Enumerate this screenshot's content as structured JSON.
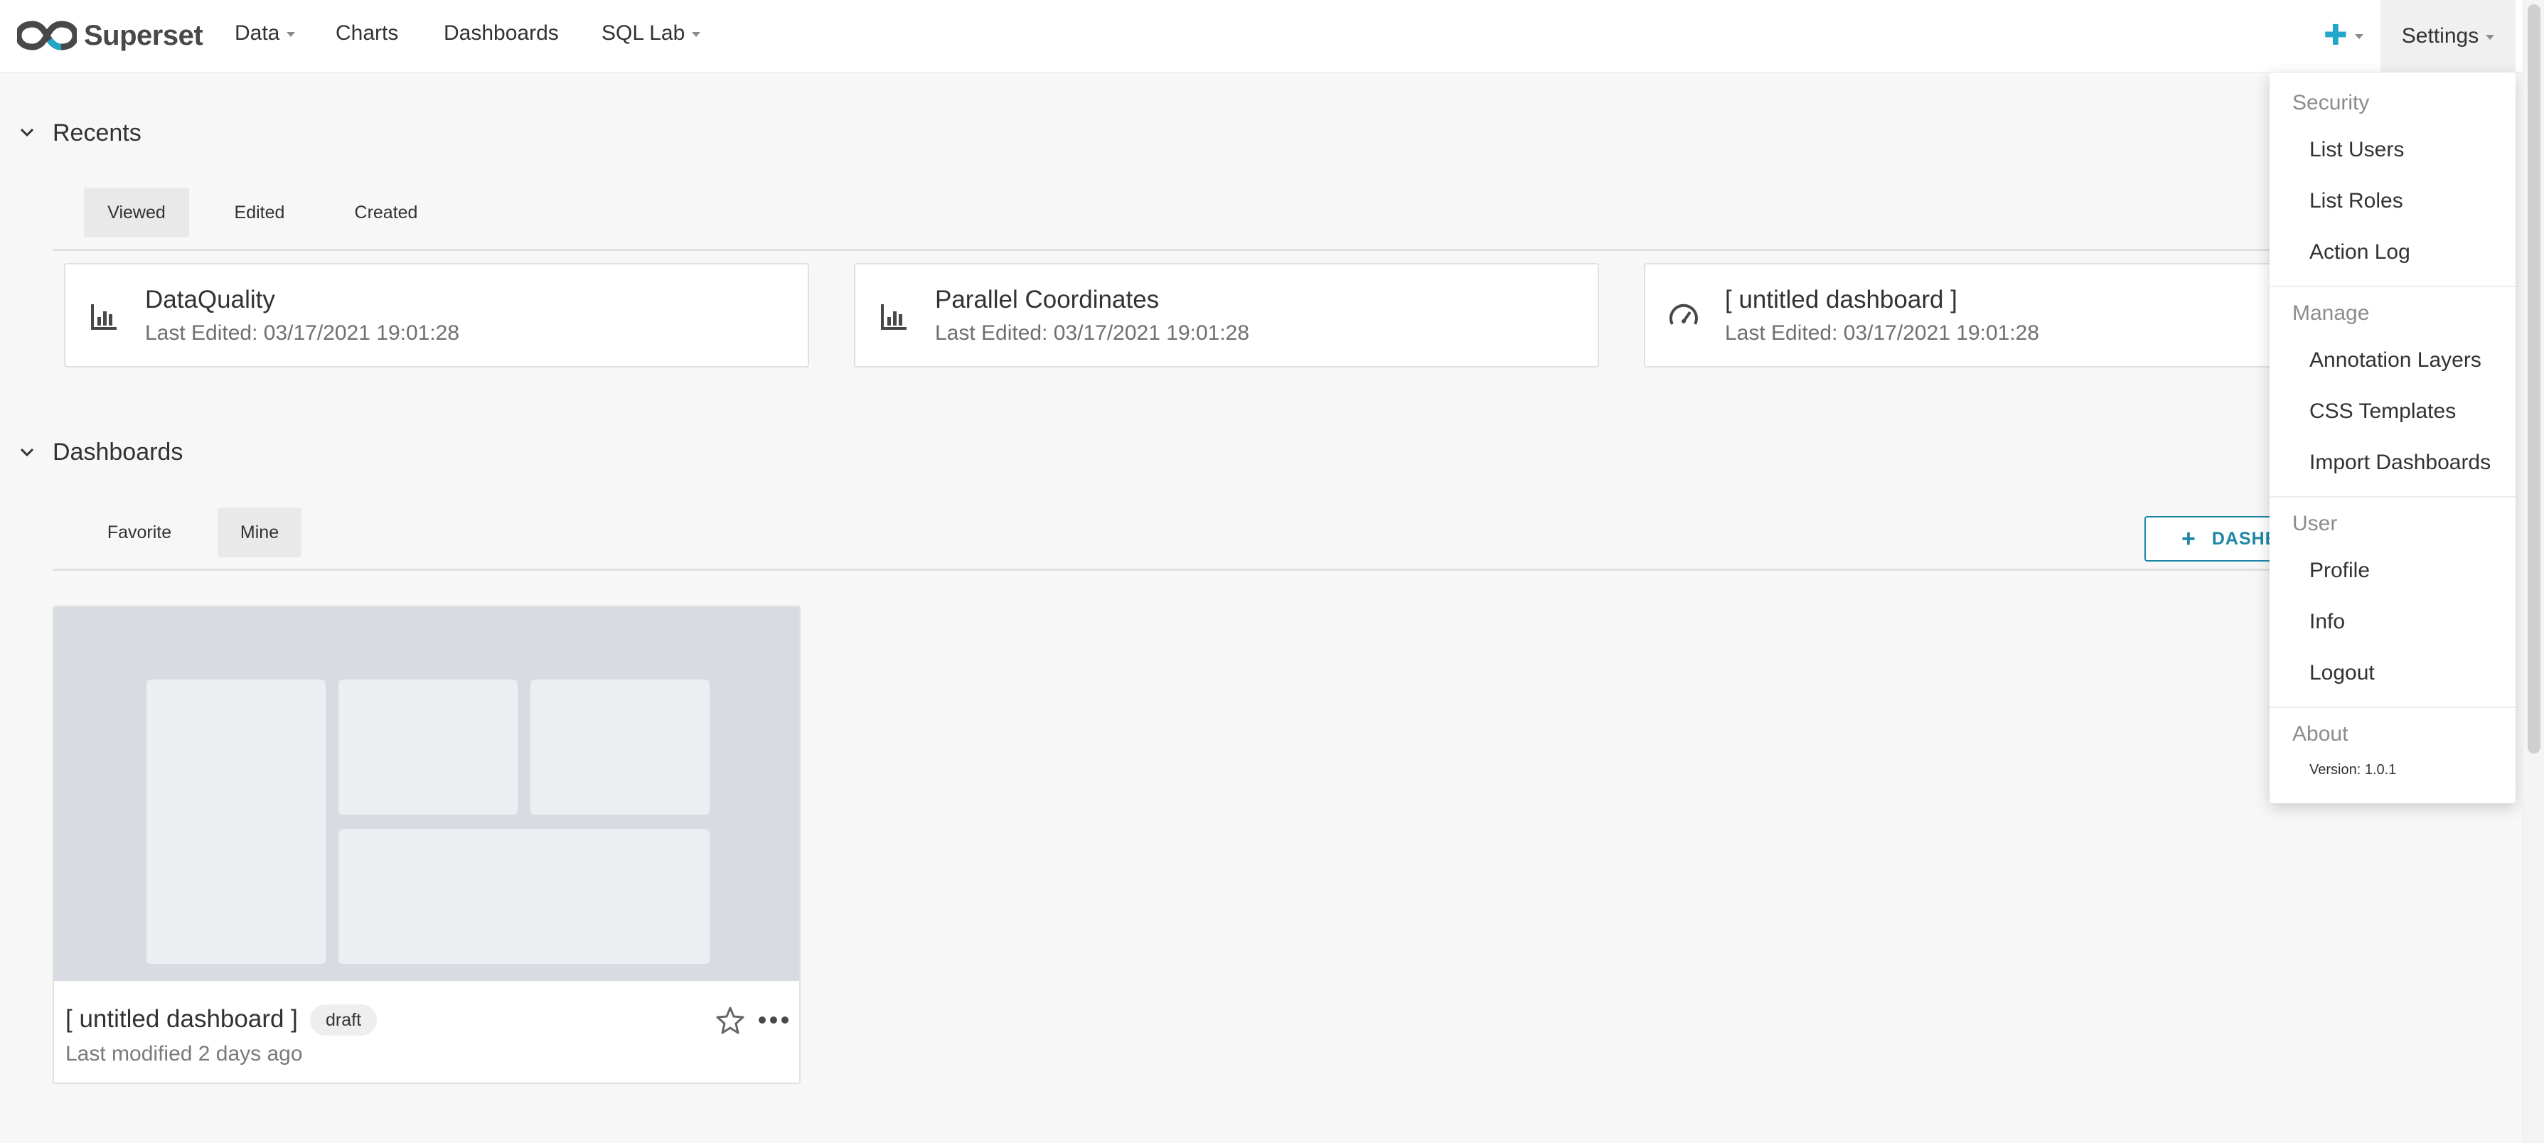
{
  "navbar": {
    "brand": "Superset",
    "menu": [
      {
        "label": "Data"
      },
      {
        "label": "Charts"
      },
      {
        "label": "Dashboards"
      },
      {
        "label": "SQL Lab"
      }
    ],
    "settings_label": "Settings"
  },
  "recents": {
    "title": "Recents",
    "tabs": [
      "Viewed",
      "Edited",
      "Created"
    ],
    "active_tab": "Viewed",
    "cards": [
      {
        "title": "DataQuality",
        "subtitle": "Last Edited: 03/17/2021 19:01:28",
        "icon": "bar-chart-icon"
      },
      {
        "title": "Parallel Coordinates",
        "subtitle": "Last Edited: 03/17/2021 19:01:28",
        "icon": "bar-chart-icon"
      },
      {
        "title": "[ untitled dashboard ]",
        "subtitle": "Last Edited: 03/17/2021 19:01:28",
        "icon": "dashboard-gauge-icon"
      }
    ]
  },
  "dashboards": {
    "title": "Dashboards",
    "tabs": [
      "Favorite",
      "Mine"
    ],
    "active_tab": "Mine",
    "add_button_label": "DASHBOARD",
    "card": {
      "title": "[ untitled dashboard ]",
      "badge": "draft",
      "subtitle": "Last modified 2 days ago"
    }
  },
  "settings_menu": {
    "groups": [
      {
        "label": "Security",
        "items": [
          "List Users",
          "List Roles",
          "Action Log"
        ]
      },
      {
        "label": "Manage",
        "items": [
          "Annotation Layers",
          "CSS Templates",
          "Import Dashboards"
        ]
      },
      {
        "label": "User",
        "items": [
          "Profile",
          "Info",
          "Logout"
        ]
      },
      {
        "label": "About",
        "items": []
      }
    ],
    "version": "Version: 1.0.1"
  },
  "colors": {
    "accent": "#20a7c9",
    "primary_button": "#1c86a7",
    "background": "#f7f7f7"
  }
}
